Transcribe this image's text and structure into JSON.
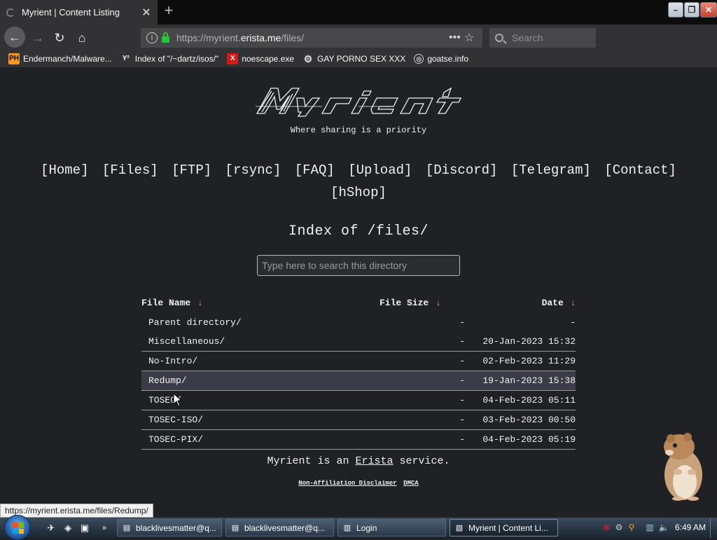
{
  "browser": {
    "tab_title": "Myrient | Content Listing",
    "url_prefix": "https://myrient.",
    "url_domain": "erista.me",
    "url_suffix": "/files/",
    "search_placeholder": "Search",
    "bookmarks": [
      {
        "label": "Endermanch/Malware...",
        "icon": "ph-icon"
      },
      {
        "label": "Index of \"/~dartz/isos/\"",
        "icon": "yc-icon"
      },
      {
        "label": "noescape.exe",
        "icon": "x-icon"
      },
      {
        "label": "GAY PORNO SEX XXX",
        "icon": "cog-icon"
      },
      {
        "label": "goatse.info",
        "icon": "globe-icon"
      }
    ],
    "status_url": "https://myrient.erista.me/files/Redump/"
  },
  "page": {
    "tagline": "Where sharing is a priority",
    "nav": [
      "[Home]",
      "[Files]",
      "[FTP]",
      "[rsync]",
      "[FAQ]",
      "[Upload]",
      "[Discord]",
      "[Telegram]",
      "[Contact]",
      "[hShop]"
    ],
    "index_title": "Index of /files/",
    "search_placeholder": "Type here to search this directory",
    "table": {
      "headers": {
        "name": "File Name",
        "size": "File Size",
        "date": "Date",
        "sort_arrow": "↓"
      },
      "rows": [
        {
          "name": "Parent directory/",
          "size": "-",
          "date": "-"
        },
        {
          "name": "Miscellaneous/",
          "size": "-",
          "date": "20-Jan-2023 15:32"
        },
        {
          "name": "No-Intro/",
          "size": "-",
          "date": "02-Feb-2023 11:29"
        },
        {
          "name": "Redump/",
          "size": "-",
          "date": "19-Jan-2023 15:38"
        },
        {
          "name": "TOSEC/",
          "size": "-",
          "date": "04-Feb-2023 05:11"
        },
        {
          "name": "TOSEC-ISO/",
          "size": "-",
          "date": "03-Feb-2023 00:50"
        },
        {
          "name": "TOSEC-PIX/",
          "size": "-",
          "date": "04-Feb-2023 05:19"
        }
      ]
    },
    "footer": {
      "prefix": "Myrient is an ",
      "link": "Erista",
      "suffix": " service."
    },
    "footer_links": [
      "Non-Affiliation Disclaimer",
      "DMCA"
    ]
  },
  "taskbar": {
    "tasks": [
      "blacklivesmatter@q...",
      "blacklivesmatter@q...",
      "Login",
      "Myrient | Content Li..."
    ],
    "clock": "6:49 AM"
  }
}
